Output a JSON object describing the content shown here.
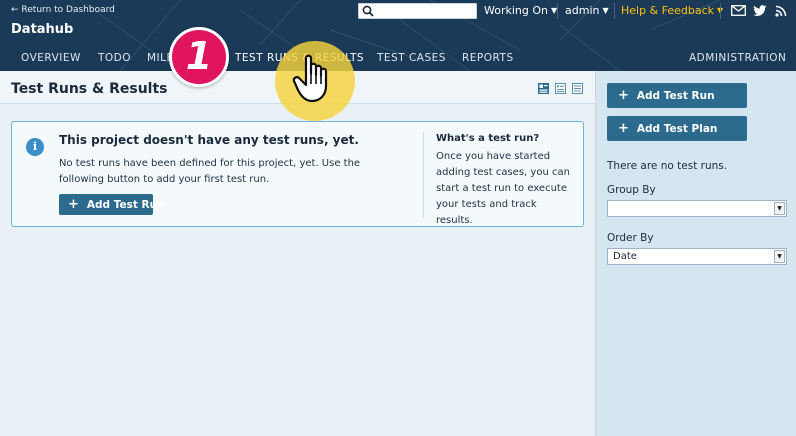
{
  "header": {
    "back_link": "← Return to Dashboard",
    "project_name": "Datahub",
    "working_on": "Working On",
    "user": "admin",
    "help": "Help & Feedback"
  },
  "tabs": [
    {
      "label": "OVERVIEW"
    },
    {
      "label": "TODO"
    },
    {
      "label": "MILE"
    },
    {
      "label": "TEST RUNS & RESULTS"
    },
    {
      "label": "TEST CASES"
    },
    {
      "label": "REPORTS"
    },
    {
      "label": "ADMINISTRATION"
    }
  ],
  "main": {
    "title": "Test Runs & Results",
    "info_heading": "This project doesn't have any test runs, yet.",
    "info_text": "No test runs have been defined for this project, yet. Use the following button to add your first test run.",
    "add_button": "Add Test Run",
    "side_heading": "What's a test run?",
    "side_text": "Once you have started adding test cases, you can start a test run to execute your tests and track results."
  },
  "sidebar": {
    "add_test_run": "Add Test Run",
    "add_test_plan": "Add Test Plan",
    "empty_text": "There are no test runs.",
    "group_by_label": "Group By",
    "group_by_value": "",
    "order_by_label": "Order By",
    "order_by_value": "Date"
  },
  "overlay": {
    "step_number": "1"
  },
  "colors": {
    "header_bg": "#1b3a57",
    "accent_yellow": "#ffc20e",
    "button_bg": "#2c6a8e",
    "step_badge": "#e0145f"
  },
  "icons": [
    "search-icon",
    "chevron-down-icon",
    "mail-icon",
    "twitter-icon",
    "rss-icon",
    "info-icon",
    "plus-icon",
    "hand-cursor-icon"
  ]
}
